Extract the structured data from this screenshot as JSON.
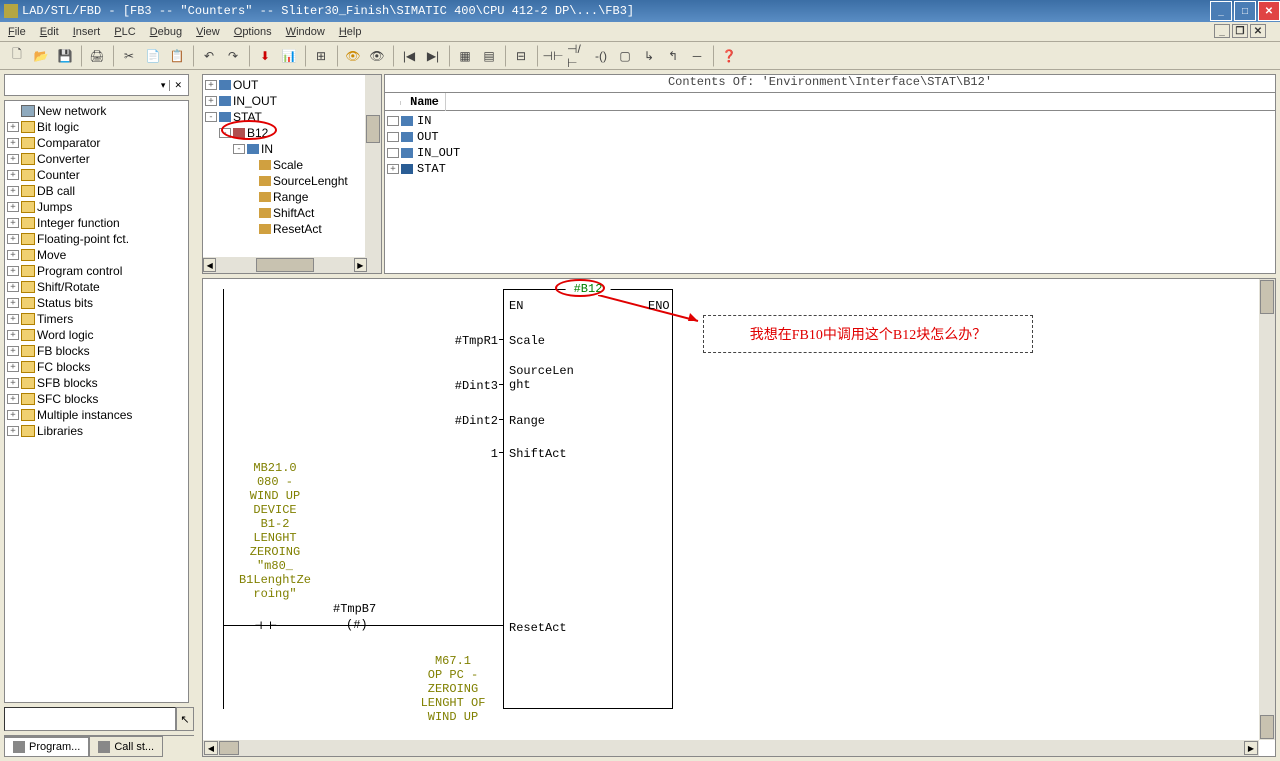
{
  "title": "LAD/STL/FBD  - [FB3 -- \"Counters\" -- Sliter30_Finish\\SIMATIC 400\\CPU 412-2 DP\\...\\FB3]",
  "menu": {
    "file": "File",
    "edit": "Edit",
    "insert": "Insert",
    "plc": "PLC",
    "debug": "Debug",
    "view": "View",
    "options": "Options",
    "window": "Window",
    "help": "Help"
  },
  "contents_header": "Contents Of: 'Environment\\Interface\\STAT\\B12'",
  "table": {
    "name_header": "Name"
  },
  "palette_title": "New network",
  "palette_items": [
    "Bit logic",
    "Comparator",
    "Converter",
    "Counter",
    "DB call",
    "Jumps",
    "Integer function",
    "Floating-point fct.",
    "Move",
    "Program control",
    "Shift/Rotate",
    "Status bits",
    "Timers",
    "Word logic",
    "FB blocks",
    "FC blocks",
    "SFB blocks",
    "SFC blocks",
    "Multiple instances",
    "Libraries"
  ],
  "vartree": {
    "out": "OUT",
    "in_out": "IN_OUT",
    "stat": "STAT",
    "b12": "B12",
    "in": "IN",
    "children": [
      "Scale",
      "SourceLenght",
      "Range",
      "ShiftAct",
      "ResetAct"
    ]
  },
  "iface_rows": [
    "IN",
    "OUT",
    "IN_OUT",
    "STAT"
  ],
  "block": {
    "title": "#B12",
    "left": [
      "EN",
      "Scale",
      "SourceLen\nght",
      "Range",
      "ShiftAct",
      "ResetAct"
    ],
    "right": [
      "ENO"
    ],
    "inputs": [
      "",
      "#TmpR1",
      "",
      "#Dint3",
      "#Dint2",
      "1"
    ],
    "comment1": "MB21.0\n080 -\nWIND UP\nDEVICE\nB1-2\nLENGHT\nZEROING\n\"m80_\nB1LenghtZe\nroing\"",
    "tmpb7": "#TmpB7",
    "hash": "(#)",
    "comment2": "M67.1\nOP PC -\nZEROING\nLENGHT OF\nWIND UP"
  },
  "annotation": "我想在FB10中调用这个B12块怎么办？",
  "tabs": {
    "program": "Program...",
    "callst": "Call st..."
  }
}
